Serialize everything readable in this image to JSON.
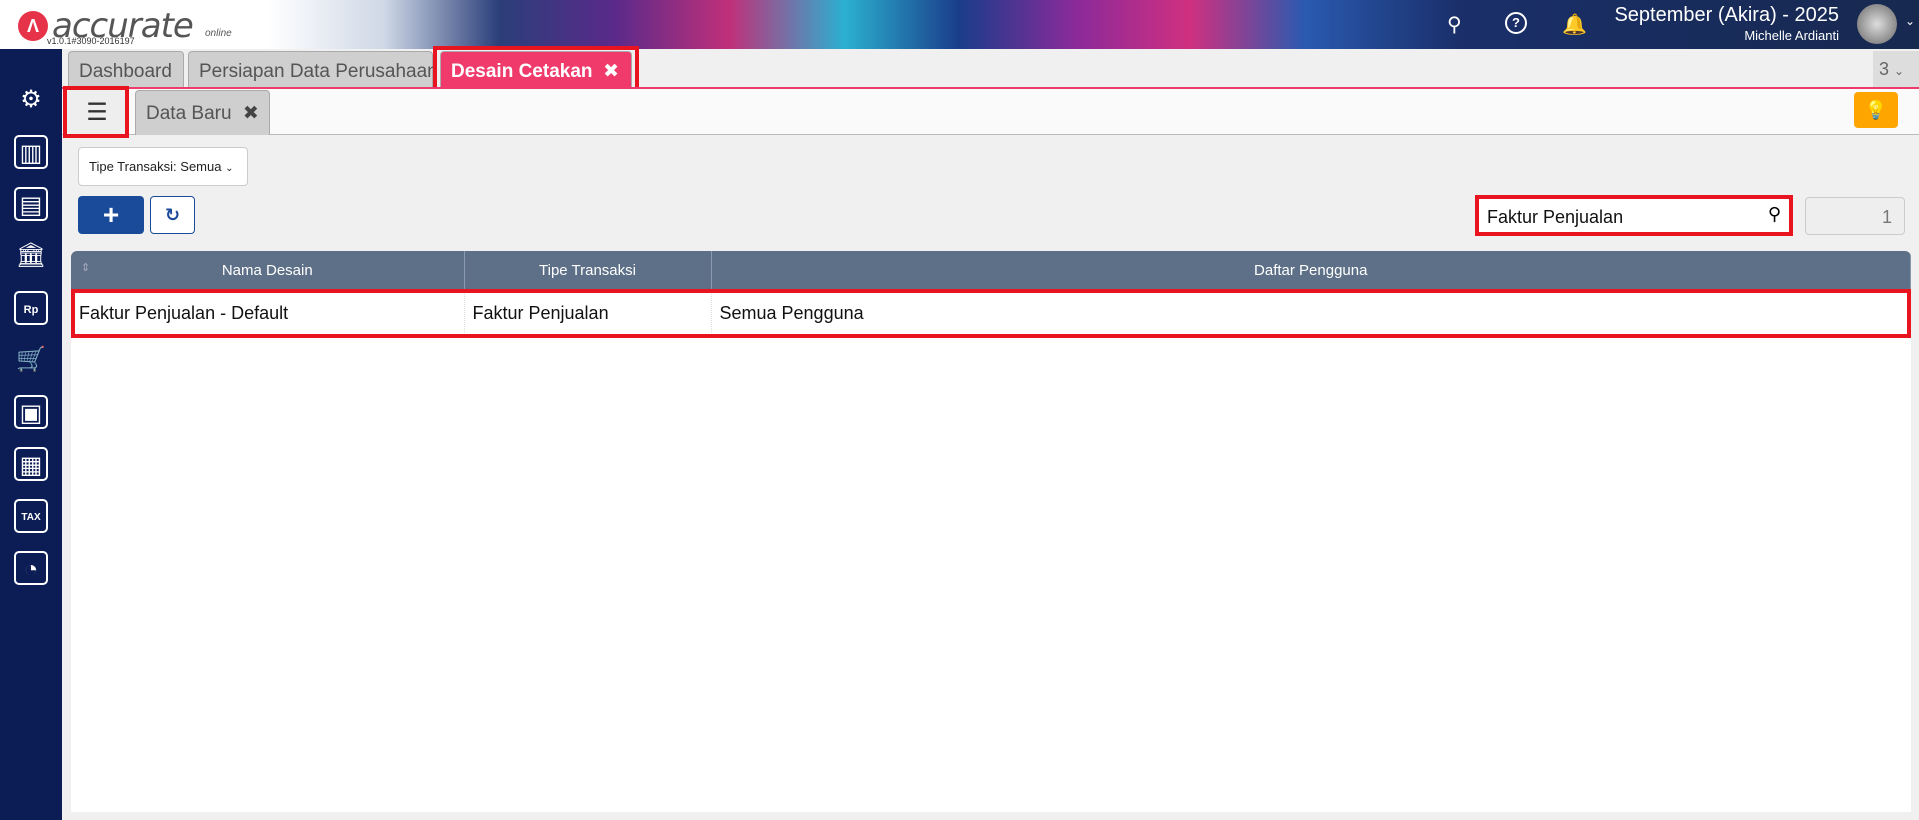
{
  "app": {
    "logo_text": "accurate",
    "logo_sub": "online",
    "version": "v1.0.1#3090-2016197",
    "period": "September (Akira) - 2025",
    "user": "Michelle Ardianti"
  },
  "header_icons": [
    "search-icon",
    "help-icon",
    "bell-icon"
  ],
  "sidebar": {
    "items": [
      "settings-icon",
      "company-icon",
      "ledger-icon",
      "bank-icon",
      "sales-icon",
      "purchase-cart-icon",
      "inventory-icon",
      "asset-icon",
      "tax-icon",
      "report-icon"
    ]
  },
  "tabs": [
    {
      "label": "Dashboard"
    },
    {
      "label": "Persiapan Data Perusahaan"
    },
    {
      "label": "Desain Cetakan",
      "active": true
    }
  ],
  "tab_count": "3",
  "subtabs": {
    "data_baru": "Data Baru"
  },
  "filter": {
    "label": "Tipe Transaksi: Semua"
  },
  "search": {
    "value": "Faktur Penjualan"
  },
  "record_count": "1",
  "table": {
    "columns": [
      "Nama Desain",
      "Tipe Transaksi",
      "Daftar Pengguna"
    ],
    "rows": [
      [
        "Faktur Penjualan - Default",
        "Faktur Penjualan",
        "Semua Pengguna"
      ]
    ]
  },
  "colors": {
    "accent": "#ef3a6b",
    "primary": "#1a4b9a",
    "sidebar": "#0c1d55",
    "header_table": "#5d7087",
    "hint": "#ffa500",
    "highlight": "#e8141f"
  }
}
